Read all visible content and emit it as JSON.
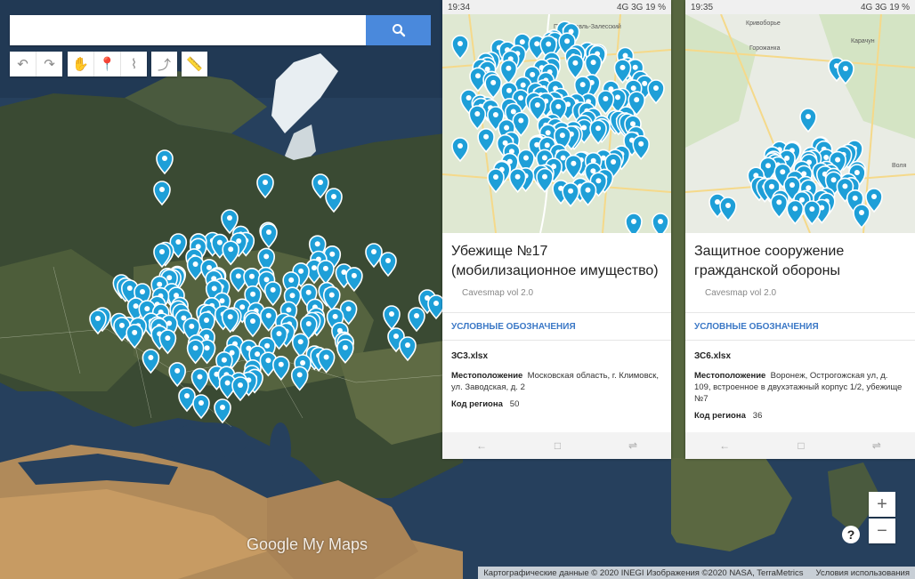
{
  "map": {
    "brand": "Google My Maps",
    "attribution": "Картографические данные © 2020 INEGI Изображения ©2020 NASA, TerraMetrics",
    "terms": "Условия использования",
    "zoom_in": "+",
    "zoom_out": "−",
    "help": "?"
  },
  "search": {
    "placeholder": "",
    "value": ""
  },
  "toolbar": {
    "undo": "↶",
    "redo": "↷",
    "pan": "✋",
    "marker": "📍",
    "line": "⌇",
    "route": "⤴",
    "measure": "📏"
  },
  "phone1": {
    "time": "19:34",
    "status_right": "4G 3G 19 %",
    "map_label": "Переславль-Залесский",
    "title": "Убежище №17 (мобилизационное имущество)",
    "subtitle": "Cavesmap vol 2.0",
    "legend": "УСЛОВНЫЕ ОБОЗНАЧЕНИЯ",
    "sheet": "ЗС3.xlsx",
    "loc_label": "Местоположение",
    "loc_value": "Московская область, г. Климовск, ул. Заводская, д. 2",
    "code_label": "Код региона",
    "code_value": "50"
  },
  "phone2": {
    "time": "19:35",
    "status_right": "4G 3G 19 %",
    "map_labels": [
      "Кривоборье",
      "Горожанка",
      "Карачун",
      "Воля"
    ],
    "title": "Защитное сооружение гражданской обороны",
    "subtitle": "Cavesmap vol 2.0",
    "legend": "УСЛОВНЫЕ ОБОЗНАЧЕНИЯ",
    "sheet": "ЗС6.xlsx",
    "loc_label": "Местоположение",
    "loc_value": "Воронеж, Острогожская ул, д. 109, встроенное в двухэтажный корпус 1/2, убежище №7",
    "code_label": "Код региона",
    "code_value": "36"
  },
  "colors": {
    "pin": "#1e9fd8",
    "accent": "#4a89dc"
  }
}
